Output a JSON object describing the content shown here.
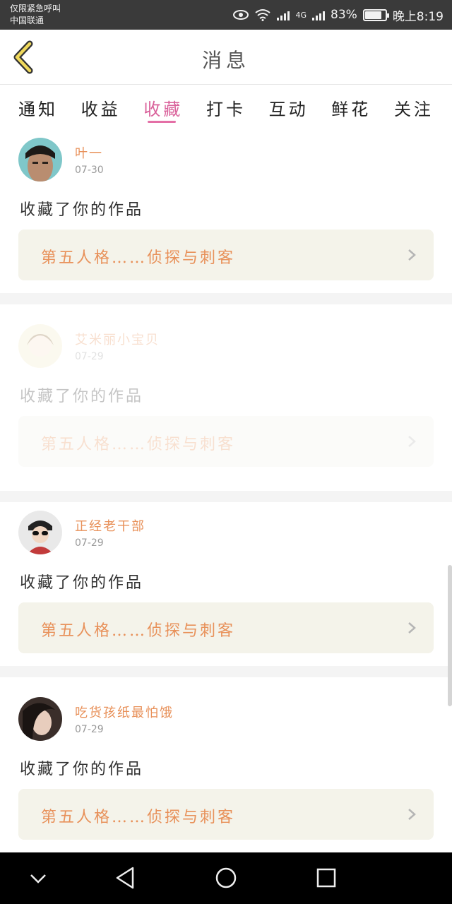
{
  "status_bar": {
    "line1": "仅限紧急呼叫",
    "line2": "中国联通",
    "network": "4G",
    "battery": "83%",
    "time": "晚上8:19"
  },
  "header": {
    "title": "消息"
  },
  "tabs": [
    {
      "label": "通知"
    },
    {
      "label": "收益"
    },
    {
      "label": "收藏",
      "active": true
    },
    {
      "label": "打卡"
    },
    {
      "label": "互动"
    },
    {
      "label": "鲜花"
    },
    {
      "label": "关注"
    }
  ],
  "messages": [
    {
      "user": "叶一",
      "date": "07-30",
      "action": "收藏了你的作品",
      "work": "第五人格……侦探与刺客"
    },
    {
      "user": "艾米丽小宝贝",
      "date": "07-29",
      "action": "收藏了你的作品",
      "work": "第五人格……侦探与刺客"
    },
    {
      "user": "正经老干部",
      "date": "07-29",
      "action": "收藏了你的作品",
      "work": "第五人格……侦探与刺客"
    },
    {
      "user": "吃货孩纸最怕饿",
      "date": "07-29",
      "action": "收藏了你的作品",
      "work": "第五人格……侦探与刺客"
    }
  ],
  "colors": {
    "accent_pink": "#d9609a",
    "username_orange": "#e8915a",
    "work_bg": "#f4f3ea"
  },
  "icons": {
    "back": "chevron-left-icon",
    "work_arrow": "chevron-right-icon",
    "nav": [
      "nav-down-icon",
      "nav-back-icon",
      "nav-home-icon",
      "nav-recents-icon"
    ]
  }
}
